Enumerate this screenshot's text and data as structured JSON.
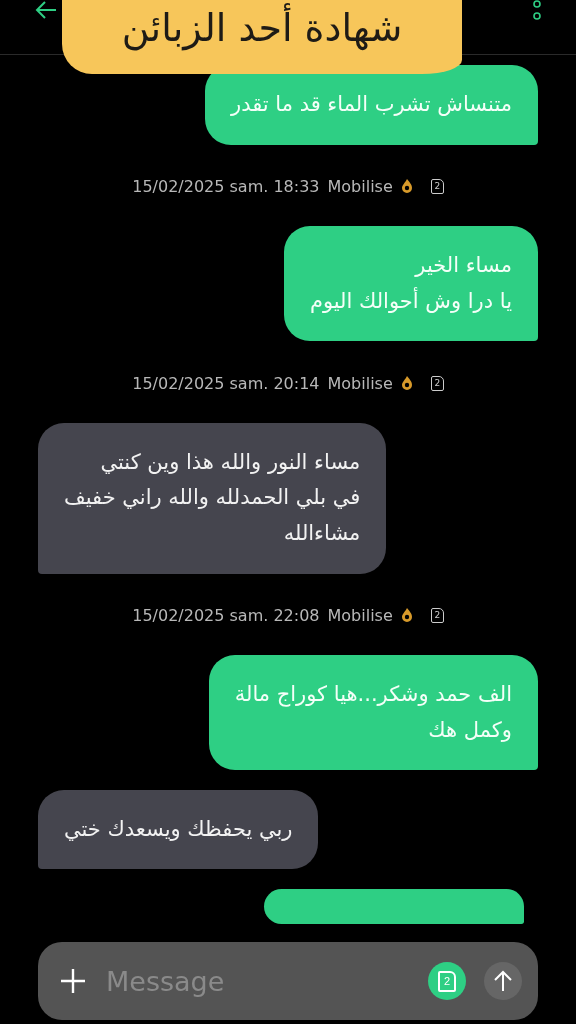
{
  "header": {
    "title": "شهادة أحد الزبائن"
  },
  "thread": [
    {
      "kind": "sent",
      "text": "متنساش تشرب الماء قد ما تقدر"
    },
    {
      "kind": "timestamp",
      "text": "15/02/2025 sam. 18:33",
      "status": "Mobilise",
      "sim": "2"
    },
    {
      "kind": "sent",
      "text": "مساء الخير\nيا درا وش أحوالك اليوم"
    },
    {
      "kind": "timestamp",
      "text": "15/02/2025 sam. 20:14",
      "status": "Mobilise",
      "sim": "2"
    },
    {
      "kind": "received",
      "text": "مساء النور والله هذا وين كنتي\nفي بلي الحمدلله والله راني خفيف\nمشاءالله"
    },
    {
      "kind": "timestamp",
      "text": "15/02/2025 sam. 22:08",
      "status": "Mobilise",
      "sim": "2"
    },
    {
      "kind": "sent",
      "text": "الف حمد وشكر...هيا كوراج مالة\nوكمل هك"
    },
    {
      "kind": "received",
      "text": "ربي يحفظك ويسعدك ختي"
    },
    {
      "kind": "sent"
    }
  ],
  "composer": {
    "placeholder": "Message",
    "sim": "2"
  }
}
